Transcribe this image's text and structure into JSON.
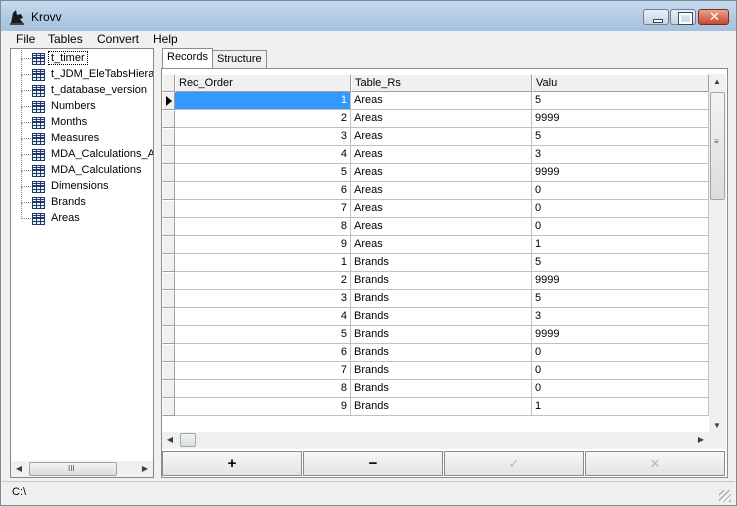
{
  "window": {
    "title": "Krovv"
  },
  "menu": [
    {
      "label": "File"
    },
    {
      "label": "Tables"
    },
    {
      "label": "Convert"
    },
    {
      "label": "Help"
    }
  ],
  "tree": {
    "items": [
      {
        "label": "t_timer",
        "selected": true
      },
      {
        "label": "t_JDM_EleTabsHiera"
      },
      {
        "label": "t_database_version"
      },
      {
        "label": "Numbers"
      },
      {
        "label": "Months"
      },
      {
        "label": "Measures"
      },
      {
        "label": "MDA_Calculations_A"
      },
      {
        "label": "MDA_Calculations"
      },
      {
        "label": "Dimensions"
      },
      {
        "label": "Brands"
      },
      {
        "label": "Areas"
      }
    ],
    "scroll_grip": "III"
  },
  "tabs": [
    {
      "label": "Records",
      "active": true
    },
    {
      "label": "Structure"
    }
  ],
  "grid": {
    "columns": [
      "Rec_Order",
      "Table_Rs",
      "Valu"
    ],
    "rows": [
      [
        "1",
        "Areas",
        "5"
      ],
      [
        "2",
        "Areas",
        "9999"
      ],
      [
        "3",
        "Areas",
        "5"
      ],
      [
        "4",
        "Areas",
        "3"
      ],
      [
        "5",
        "Areas",
        "9999"
      ],
      [
        "6",
        "Areas",
        "0"
      ],
      [
        "7",
        "Areas",
        "0"
      ],
      [
        "8",
        "Areas",
        "0"
      ],
      [
        "9",
        "Areas",
        "1"
      ],
      [
        "1",
        "Brands",
        "5"
      ],
      [
        "2",
        "Brands",
        "9999"
      ],
      [
        "3",
        "Brands",
        "5"
      ],
      [
        "4",
        "Brands",
        "3"
      ],
      [
        "5",
        "Brands",
        "9999"
      ],
      [
        "6",
        "Brands",
        "0"
      ],
      [
        "7",
        "Brands",
        "0"
      ],
      [
        "8",
        "Brands",
        "0"
      ],
      [
        "9",
        "Brands",
        "1"
      ]
    ],
    "current_row": 0
  },
  "navigator": {
    "add": "+",
    "delete": "−",
    "post": "✓",
    "cancel": "✕"
  },
  "status": {
    "text": "C:\\"
  }
}
